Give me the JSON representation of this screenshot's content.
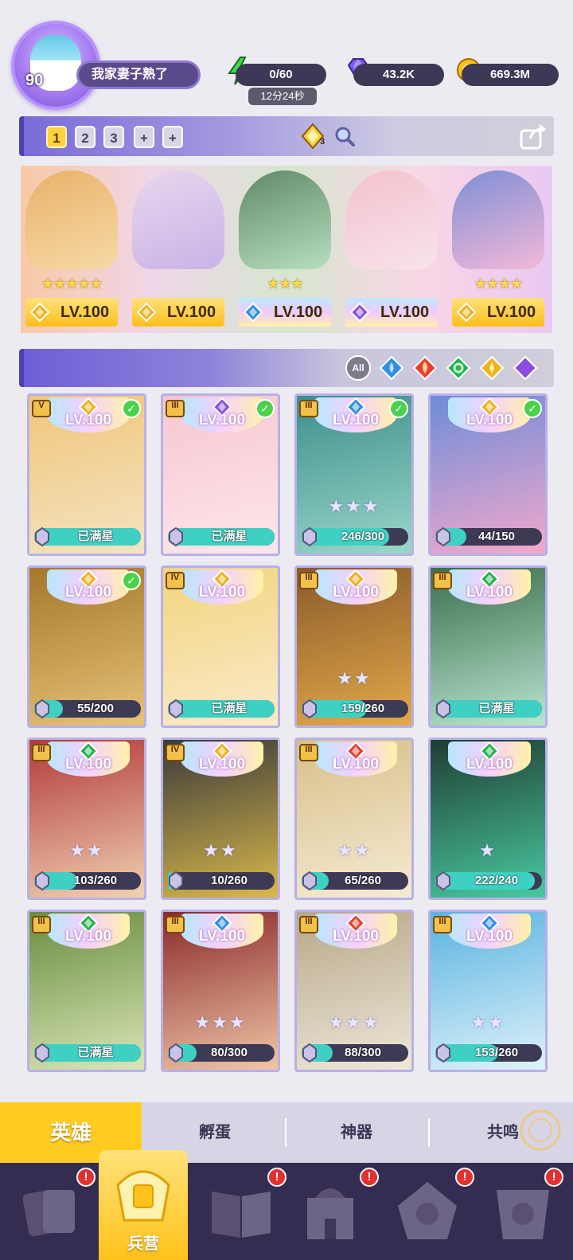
{
  "player": {
    "level": "90",
    "name": "我家妻子熟了"
  },
  "resources": {
    "energy": "0/60",
    "energy_timer": "12分24秒",
    "gems": "43.2K",
    "gold": "669.3M"
  },
  "formation": {
    "slots": [
      "1",
      "2",
      "3",
      "+",
      "+"
    ],
    "active_slot": 0,
    "diamond_count": "3"
  },
  "lineup": [
    {
      "level": "LV.100",
      "stars": "★★★★★",
      "element": "light",
      "art": [
        "#e9b26a",
        "#f6d9a6"
      ]
    },
    {
      "level": "LV.100",
      "stars": "",
      "element": "light",
      "art": [
        "#e8d6ef",
        "#c9b3e6"
      ]
    },
    {
      "level": "LV.100",
      "stars": "★★★",
      "element": "water",
      "art": [
        "#5e8a66",
        "#b8dec0"
      ]
    },
    {
      "level": "LV.100",
      "stars": "",
      "element": "dark",
      "art": [
        "#f3c2cf",
        "#f8e3e9"
      ]
    },
    {
      "level": "LV.100",
      "stars": "★★★★",
      "element": "light",
      "art": [
        "#7e8fd6",
        "#f3b8d8"
      ]
    }
  ],
  "filters": {
    "all_label": "All",
    "elements": [
      "water",
      "fire",
      "wind",
      "light",
      "dark"
    ]
  },
  "heroes": [
    {
      "rank": "V",
      "element": "light",
      "level": "LV.100",
      "checked": true,
      "stars": "",
      "progress": "已满星",
      "fill": 1.0,
      "art": [
        "#f0c67a",
        "#f5e3c2"
      ]
    },
    {
      "rank": "III",
      "element": "dark",
      "level": "LV.100",
      "checked": true,
      "stars": "",
      "progress": "已满星",
      "fill": 1.0,
      "art": [
        "#f7c6cf",
        "#fde7ea"
      ]
    },
    {
      "rank": "III",
      "element": "water",
      "level": "LV.100",
      "checked": true,
      "stars": "★★★",
      "progress": "246/300",
      "fill": 0.82,
      "art": [
        "#3e8e8c",
        "#9ad7c9"
      ]
    },
    {
      "rank": "",
      "element": "light",
      "level": "LV.100",
      "checked": true,
      "stars": "",
      "progress": "44/150",
      "fill": 0.29,
      "art": [
        "#6f8cd8",
        "#f2a9cc"
      ]
    },
    {
      "rank": "",
      "element": "light",
      "level": "LV.100",
      "checked": true,
      "stars": "",
      "progress": "55/200",
      "fill": 0.27,
      "art": [
        "#a5782a",
        "#e6c27a"
      ]
    },
    {
      "rank": "IV",
      "element": "light",
      "level": "LV.100",
      "checked": false,
      "stars": "",
      "progress": "已满星",
      "fill": 1.0,
      "art": [
        "#f2d57e",
        "#fbe9c9"
      ]
    },
    {
      "rank": "III",
      "element": "light",
      "level": "LV.100",
      "checked": false,
      "stars": "★★",
      "progress": "159/260",
      "fill": 0.61,
      "art": [
        "#8a5b2a",
        "#e3a94a"
      ]
    },
    {
      "rank": "III",
      "element": "wind",
      "level": "LV.100",
      "checked": false,
      "stars": "",
      "progress": "已满星",
      "fill": 1.0,
      "art": [
        "#3d6e4e",
        "#b8e6cf"
      ]
    },
    {
      "rank": "III",
      "element": "wind",
      "level": "LV.100",
      "checked": false,
      "stars": "★★",
      "progress": "103/260",
      "fill": 0.4,
      "art": [
        "#b23a3a",
        "#f0d1b0"
      ]
    },
    {
      "rank": "IV",
      "element": "light",
      "level": "LV.100",
      "checked": false,
      "stars": "★★",
      "progress": "10/260",
      "fill": 0.04,
      "art": [
        "#3a3a3a",
        "#d9b84a"
      ]
    },
    {
      "rank": "III",
      "element": "fire",
      "level": "LV.100",
      "checked": false,
      "stars": "★★",
      "progress": "65/260",
      "fill": 0.25,
      "art": [
        "#d8c08a",
        "#f6ead2"
      ]
    },
    {
      "rank": "",
      "element": "wind",
      "level": "LV.100",
      "checked": false,
      "stars": "★",
      "progress": "222/240",
      "fill": 0.93,
      "art": [
        "#1f3d33",
        "#49c9a1"
      ]
    },
    {
      "rank": "III",
      "element": "wind",
      "level": "LV.100",
      "checked": false,
      "stars": "",
      "progress": "已满星",
      "fill": 1.0,
      "art": [
        "#6a8d3f",
        "#d9e6b8"
      ]
    },
    {
      "rank": "III",
      "element": "water",
      "level": "LV.100",
      "checked": false,
      "stars": "★★★",
      "progress": "80/300",
      "fill": 0.27,
      "art": [
        "#8a2a2a",
        "#f0c6a6"
      ]
    },
    {
      "rank": "III",
      "element": "fire",
      "level": "LV.100",
      "checked": false,
      "stars": "★★★",
      "progress": "88/300",
      "fill": 0.29,
      "art": [
        "#b7a88a",
        "#efe7d8"
      ]
    },
    {
      "rank": "III",
      "element": "water",
      "level": "LV.100",
      "checked": false,
      "stars": "★★",
      "progress": "153/260",
      "fill": 0.59,
      "art": [
        "#5ab3e0",
        "#dff2fb"
      ]
    }
  ],
  "subtabs": [
    "英雄",
    "孵蛋",
    "神器",
    "共鸣"
  ],
  "nav": {
    "center_label": "兵营",
    "badge": "!"
  },
  "colors": {
    "accent": "#ffcc1f",
    "nav_bg": "#352c52",
    "water": "#2f8ee8",
    "fire": "#e8402a",
    "wind": "#24b24a",
    "light": "#f2b21c",
    "dark": "#8c4de0"
  }
}
